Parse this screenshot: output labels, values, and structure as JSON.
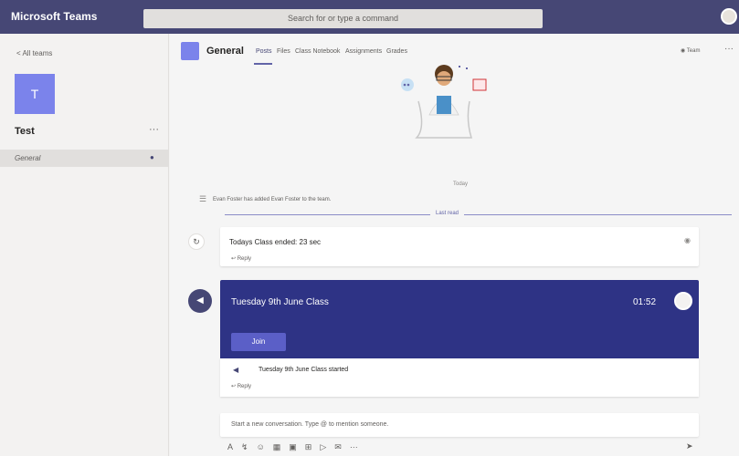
{
  "app": {
    "title": "Microsoft Teams"
  },
  "search": {
    "placeholder": "Search for or type a command"
  },
  "left": {
    "back_label": "< All teams",
    "team_initial": "T",
    "team_name": "Test",
    "more": "···",
    "channel": "General"
  },
  "header": {
    "channel_title": "General",
    "tabs": [
      "Posts",
      "Files",
      "Class Notebook",
      "Assignments",
      "Grades"
    ],
    "team_button": "◉ Team",
    "more": "···"
  },
  "feed": {
    "day_separator": "Today",
    "system_message": "Evan Foster has added Evan Foster to the team.",
    "last_read": "Last read",
    "post1": {
      "text": "Todays Class ended: 23 sec",
      "reply": "↩ Reply"
    },
    "meeting": {
      "title": "Tuesday 9th June Class",
      "time": "01:52",
      "join": "Join",
      "started": "Tuesday 9th June Class started",
      "reply": "↩ Reply"
    }
  },
  "compose": {
    "placeholder": "Start a new conversation. Type @ to mention someone.",
    "tools": [
      "A",
      "↯",
      "☺",
      "▦",
      "▣",
      "⊞",
      "▷",
      "✉",
      "···"
    ],
    "send": "➤"
  },
  "icons": {
    "back": "chevron-left-icon",
    "pin": "pin-icon",
    "system": "people-icon",
    "meeting": "video-camera-icon",
    "send": "send-icon"
  },
  "colors": {
    "topbar": "#464775",
    "accent": "#6264a7",
    "team_tile": "#7b83eb",
    "meeting_banner": "#2e3385"
  }
}
